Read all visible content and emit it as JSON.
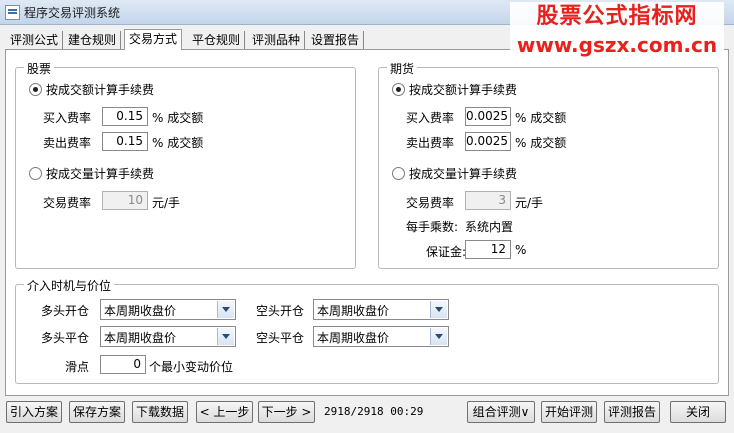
{
  "window": {
    "title": "程序交易评测系统"
  },
  "watermark": {
    "line1": "股票公式指标网",
    "line2": "www.gszx.com.cn"
  },
  "tabs": [
    "评测公式",
    "建仓规则",
    "交易方式",
    "平仓规则",
    "评测品种",
    "设置报告"
  ],
  "stock": {
    "group_title": "股票",
    "by_amount": "按成交额计算手续费",
    "buy_rate_label": "买入费率",
    "buy_rate": "0.15",
    "buy_unit": "% 成交额",
    "sell_rate_label": "卖出费率",
    "sell_rate": "0.15",
    "sell_unit": "% 成交额",
    "by_volume": "按成交量计算手续费",
    "trade_fee_label": "交易费率",
    "trade_fee": "10",
    "trade_fee_unit": "元/手"
  },
  "futures": {
    "group_title": "期货",
    "by_amount": "按成交额计算手续费",
    "buy_rate_label": "买入费率",
    "buy_rate": "0.0025",
    "buy_unit": "% 成交额",
    "sell_rate_label": "卖出费率",
    "sell_rate": "0.0025",
    "sell_unit": "% 成交额",
    "by_volume": "按成交量计算手续费",
    "trade_fee_label": "交易费率",
    "trade_fee": "3",
    "trade_fee_unit": "元/手",
    "multiplier_label": "每手乘数:",
    "multiplier_value": "系统内置",
    "margin_label": "保证金:",
    "margin": "12",
    "margin_unit": "%"
  },
  "timing": {
    "group_title": "介入时机与价位",
    "long_open_label": "多头开仓",
    "long_open": "本周期收盘价",
    "short_open_label": "空头开仓",
    "short_open": "本周期收盘价",
    "long_close_label": "多头平仓",
    "long_close": "本周期收盘价",
    "short_close_label": "空头平仓",
    "short_close": "本周期收盘价",
    "slippage_label": "滑点",
    "slippage": "0",
    "slippage_unit": "个最小变动价位"
  },
  "footer": {
    "import": "引入方案",
    "save": "保存方案",
    "download": "下载数据",
    "prev": "< 上一步",
    "next": "下一步 >",
    "progress": "2918/2918 00:29",
    "combo": "组合评测∨",
    "start": "开始评测",
    "report": "评测报告",
    "close": "关闭"
  }
}
